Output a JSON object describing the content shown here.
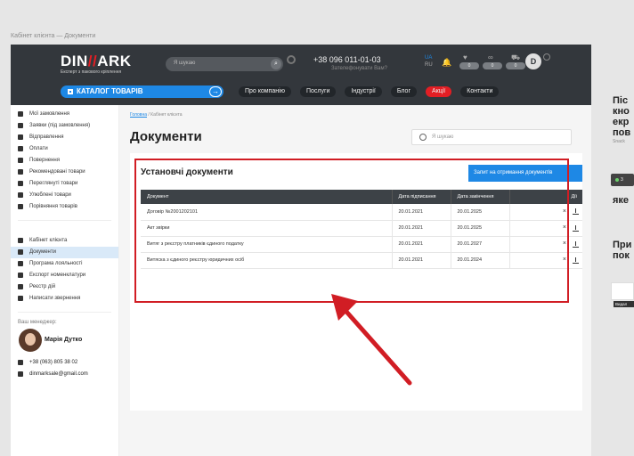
{
  "page": {
    "caption": "Кабінет клієнта — Документи"
  },
  "header": {
    "logo": {
      "main_left": "DIN",
      "main_mid": "//",
      "main_right": "ARK",
      "sub": "Експерт з пакового кріплення"
    },
    "search_placeholder": "Я шукаю",
    "phone": "+38 096 011-01-03",
    "phone_sub": "Зателефонувати Вам?",
    "lang_ua": "UA",
    "lang_ru": "RU",
    "badges": [
      "0",
      "0",
      "0"
    ],
    "catalog_label": "КАТАЛОГ ТОВАРІВ",
    "nav": [
      "Про компанію",
      "Послуги",
      "Індустрії",
      "Блог",
      "Акції",
      "Контакти"
    ]
  },
  "sidebar": {
    "items_top": [
      "Мої замовлення",
      "Заявки (під замовлення)",
      "Відправлення",
      "Оплати",
      "Повернення",
      "Рекомендовані товари",
      "Переглянуті товари",
      "Улюблені товари",
      "Порівняння товарів"
    ],
    "items_bottom": [
      "Кабінет клієнта",
      "Документи",
      "Програма лояльності",
      "Експорт номенклатури",
      "Реєстр дій",
      "Написати звернення"
    ],
    "manager_label": "Ваш менеджер:",
    "manager_name": "Марія Дутко",
    "phone": "+38 (063) 805 38 02",
    "email": "dinmarksale@gmail.com"
  },
  "content": {
    "breadcrumb_home": "Головна",
    "breadcrumb_current": "/ Кабінет клієнта",
    "title": "Документи",
    "search_placeholder": "Я шукаю",
    "card_title": "Установчі документи",
    "request_button": "Запит на отримання документів",
    "table": {
      "headers": [
        "Документ",
        "Дата підписання",
        "Дата закінчення",
        "Дії"
      ],
      "rows": [
        [
          "Договір №2001202101",
          "20.01.2021",
          "20.01.2025"
        ],
        [
          "Акт звірки",
          "20.01.2021",
          "20.01.2025"
        ],
        [
          "Витяг з реєстру платників єдиного податку",
          "20.01.2021",
          "20.01.2027"
        ],
        [
          "Витяска з єдиного реєстру юридичних осіб",
          "20.01.2021",
          "20.01.2024"
        ]
      ]
    }
  },
  "right_overflow": {
    "lines": [
      "Піс",
      "кно",
      "екр",
      "пов"
    ],
    "small": "Snack",
    "chip": "3",
    "mid": "яке",
    "lines2": [
      "При",
      "пок"
    ],
    "badge": "Видал"
  },
  "colors": {
    "accent": "#1e88e5",
    "brand_red": "#e31e24",
    "header_bg": "#33373c",
    "highlight": "#d11d24"
  }
}
